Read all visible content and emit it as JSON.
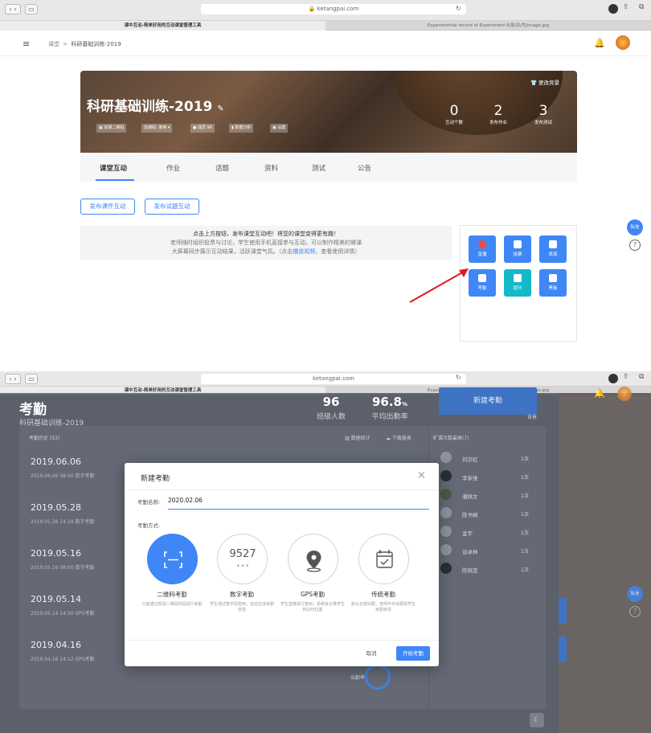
{
  "browser_top": {
    "url": "ketangpai.com",
    "tab1": "课中互动-简单好用的互动课堂管理工具",
    "tab2": "Experimental record of Experiment 6|影|弘杰|image.jpg"
  },
  "browser_bottom": {
    "url": "ketangpai.com",
    "tab1": "课中互动-简单好用的互动课堂管理工具",
    "tab2": "Experimental record of Experiment 6|影|弘杰|image.jpg"
  },
  "nav": {
    "breadcrumb_root": "课堂",
    "breadcrumb_sep": ">",
    "breadcrumb_course": "科研基础训练-2019"
  },
  "banner": {
    "course_title": "科研基础训练-2019",
    "change_bg": "更改背景",
    "qr_label": "加课二维码",
    "code_label": "加课码: 使用",
    "member_label": "成员 96",
    "analysis_label": "数据分析",
    "more_label": "设置",
    "stats": [
      {
        "value": "0",
        "label": "互动个数"
      },
      {
        "value": "2",
        "label": "发布作业"
      },
      {
        "value": "3",
        "label": "发布测试"
      }
    ]
  },
  "course_tabs": [
    "课堂互动",
    "作业",
    "话题",
    "资料",
    "测试",
    "公告"
  ],
  "actions": {
    "publish_courseware": "发布课件互动",
    "publish_question": "发布试题互动"
  },
  "tip": {
    "line1": "点击上方按钮，发布课堂互动吧！将您的课堂变得更有趣！",
    "line2": "老师随时组织投票与讨论，学生使用手机直接参与互动，可以制作精美的微课",
    "line3a": "大屏幕同步展示互动结果，活跃课堂气氛。（点击",
    "line3link": "播放视频",
    "line3b": "，查看使用详情）"
  },
  "tools": [
    "直播",
    "投票",
    "表现",
    "考勤",
    "提问",
    "黑板"
  ],
  "side": {
    "message": "私信",
    "help": "?"
  },
  "attendance": {
    "title": "考勤",
    "course": "科研基础训练-2019",
    "class_size": "96",
    "class_size_label": "班级人数",
    "avg_rate": "96.8",
    "avg_rate_unit": "%",
    "avg_rate_label": "平均出勤率",
    "new_button": "新建考勤",
    "history_label": "考勤历史 (53)",
    "stats_link": "数据统计",
    "download_link": "下载报表",
    "rank_title": "旷课次数最高(7)",
    "history": [
      {
        "date": "2019.06.06",
        "sub": "2019.06.06  08:00  数字考勤"
      },
      {
        "date": "2019.05.28",
        "sub": "2019.05.28  14:29  数字考勤"
      },
      {
        "date": "2019.05.16",
        "sub": "2019.05.16  08:00  数字考勤"
      },
      {
        "date": "2019.05.14",
        "sub": "2019.05.14  14:30  GPS考勤"
      },
      {
        "date": "2019.04.16",
        "sub": "2019.04.16  14:12  GPS考勤"
      }
    ],
    "absent_rank": [
      {
        "name": "刘京虹",
        "count": "1次"
      },
      {
        "name": "李家维",
        "count": "1次"
      },
      {
        "name": "潘佩文",
        "count": "1次"
      },
      {
        "name": "陈书桐",
        "count": "1次"
      },
      {
        "name": "金宇",
        "count": "1次"
      },
      {
        "name": "谈卓林",
        "count": "1次"
      },
      {
        "name": "陈佩莲",
        "count": "1次"
      }
    ],
    "bg_label": "背景",
    "rate_label": "出勤率"
  },
  "dialog": {
    "title": "新建考勤",
    "name_label": "考勤名称:",
    "name_value": "2020.02.06",
    "method_label": "考勤方式:",
    "methods": [
      {
        "title": "二维码考勤",
        "desc": "只能通过现场二维码扫码进行考勤"
      },
      {
        "title": "数字考勤",
        "desc": "学生通过数字码签到，自动生成考勤状态"
      },
      {
        "title": "GPS考勤",
        "desc": "学生直接进行签到，系统会记录学生的GPS位置"
      },
      {
        "title": "传统考勤",
        "desc": "默认全部出勤，老师可手动更改学生考勤状态"
      }
    ],
    "digit_sample": "9527",
    "digit_stars": "* * *",
    "cancel": "取消",
    "start": "开始考勤"
  },
  "colors": {
    "accent": "#3f86f6",
    "teal": "#14b8c9",
    "red": "#f04b3d",
    "banner": "#5a4638"
  }
}
